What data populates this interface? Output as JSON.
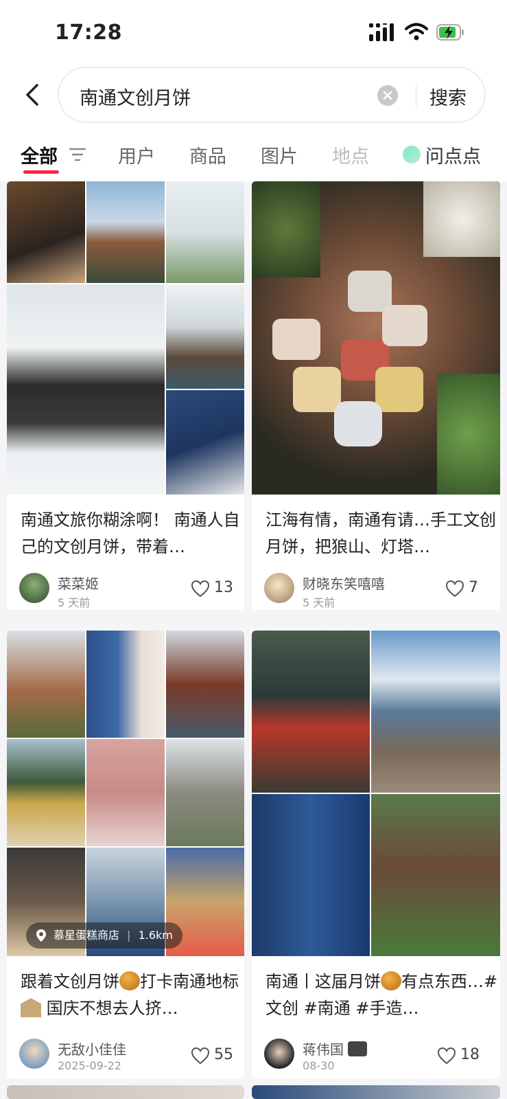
{
  "status_bar": {
    "time": "17:28"
  },
  "search": {
    "query": "南通文创月饼",
    "submit_label": "搜索"
  },
  "tabs": [
    {
      "label": "全部",
      "active": true
    },
    {
      "label": "用户"
    },
    {
      "label": "商品"
    },
    {
      "label": "图片"
    },
    {
      "label": "地点"
    },
    {
      "label": "问点点"
    }
  ],
  "feed": [
    {
      "title": "南通文旅你糊涂啊！ 南通人自己的文创月饼，带着…",
      "author": "菜菜姬",
      "time": "5 天前",
      "likes": "13"
    },
    {
      "title": "江海有情，南通有请…手工文创月饼，把狼山、灯塔…",
      "author": "财晓东笑嘻嘻",
      "time": "5 天前",
      "likes": "7"
    },
    {
      "title_part1": "跟着文创月饼",
      "title_part2": "打卡南通地标",
      "title_part3": " 国庆不想去人挤…",
      "emoji_1": "mooncake-emoji",
      "emoji_2": "classical-building-emoji",
      "author": "无敌小佳佳",
      "time": "2025-09-22",
      "likes": "55",
      "location": "慕星蛋糕商店",
      "distance": "1.6km"
    },
    {
      "title_part1": "南通丨这届月饼",
      "title_part2": "有点东西…#文创 #南通 #手造…",
      "emoji_1": "mooncake-emoji",
      "author": "蒋伟国",
      "author_emoji": "camera-emoji",
      "time": "08-30",
      "likes": "18"
    }
  ],
  "colors": {
    "accent": "#ff2442",
    "background": "#f5f5f7"
  }
}
